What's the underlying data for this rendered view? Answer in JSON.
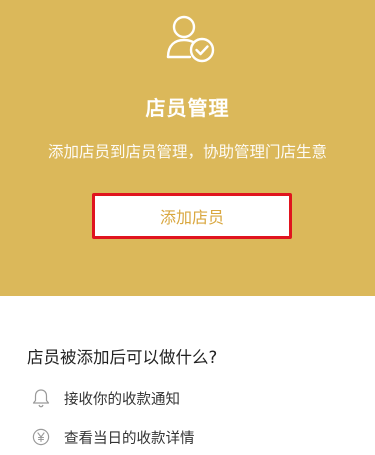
{
  "hero": {
    "icon": "user-check-icon",
    "title": "店员管理",
    "subtitle": "添加店员到店员管理，协助管理门店生意",
    "add_button_label": "添加店员"
  },
  "info": {
    "heading": "店员被添加后可以做什么?",
    "items": [
      {
        "icon": "bell-icon",
        "label": "接收你的收款通知"
      },
      {
        "icon": "yen-circle-icon",
        "label": "查看当日的收款详情"
      }
    ]
  },
  "colors": {
    "hero_bg": "#dbb85a",
    "button_text": "#d9a73f",
    "highlight_border": "#e0141e"
  }
}
